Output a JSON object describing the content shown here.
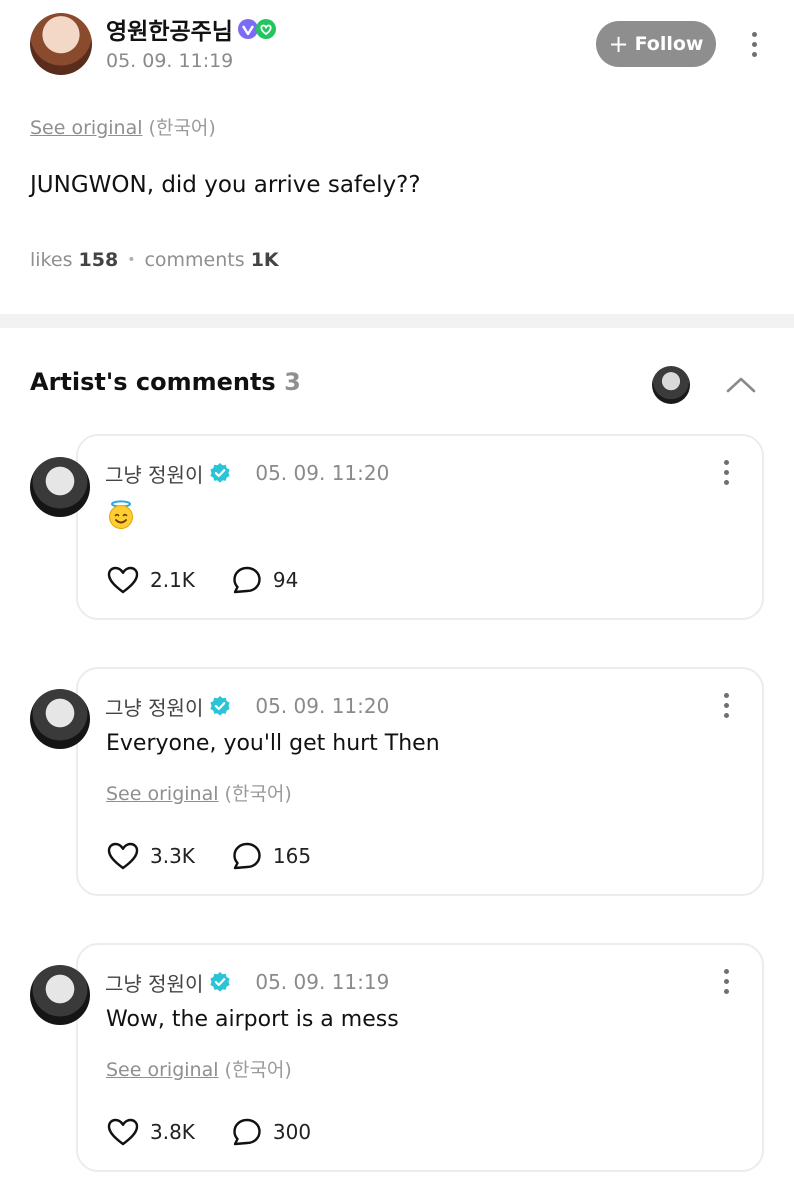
{
  "post": {
    "author": "영원한공주님",
    "timestamp": "05. 09. 11:19",
    "follow_label": "Follow",
    "see_original": "See original",
    "original_lang": "(한국어)",
    "body": "JUNGWON, did you arrive safely??",
    "likes_label": "likes",
    "likes_count": "158",
    "comments_label": "comments",
    "comments_count": "1K"
  },
  "artist_comments": {
    "title": "Artist's comments",
    "count": "3",
    "items": [
      {
        "author": "그냥 정원이",
        "timestamp": "05. 09. 11:20",
        "text": "",
        "emoji": "smiling-face-with-halo",
        "likes": "2.1K",
        "replies": "94"
      },
      {
        "author": "그냥 정원이",
        "timestamp": "05. 09. 11:20",
        "text": "Everyone, you'll get hurt Then",
        "see_original": "See original",
        "original_lang": "(한국어)",
        "likes": "3.3K",
        "replies": "165"
      },
      {
        "author": "그냥 정원이",
        "timestamp": "05. 09. 11:19",
        "text": "Wow, the airport is a mess",
        "see_original": "See original",
        "original_lang": "(한국어)",
        "likes": "3.8K",
        "replies": "300"
      }
    ]
  },
  "colors": {
    "follow_bg": "#8e8e8e",
    "verified": "#2bc4d6",
    "divider": "#f2f2f2",
    "card_border": "#ececec"
  }
}
